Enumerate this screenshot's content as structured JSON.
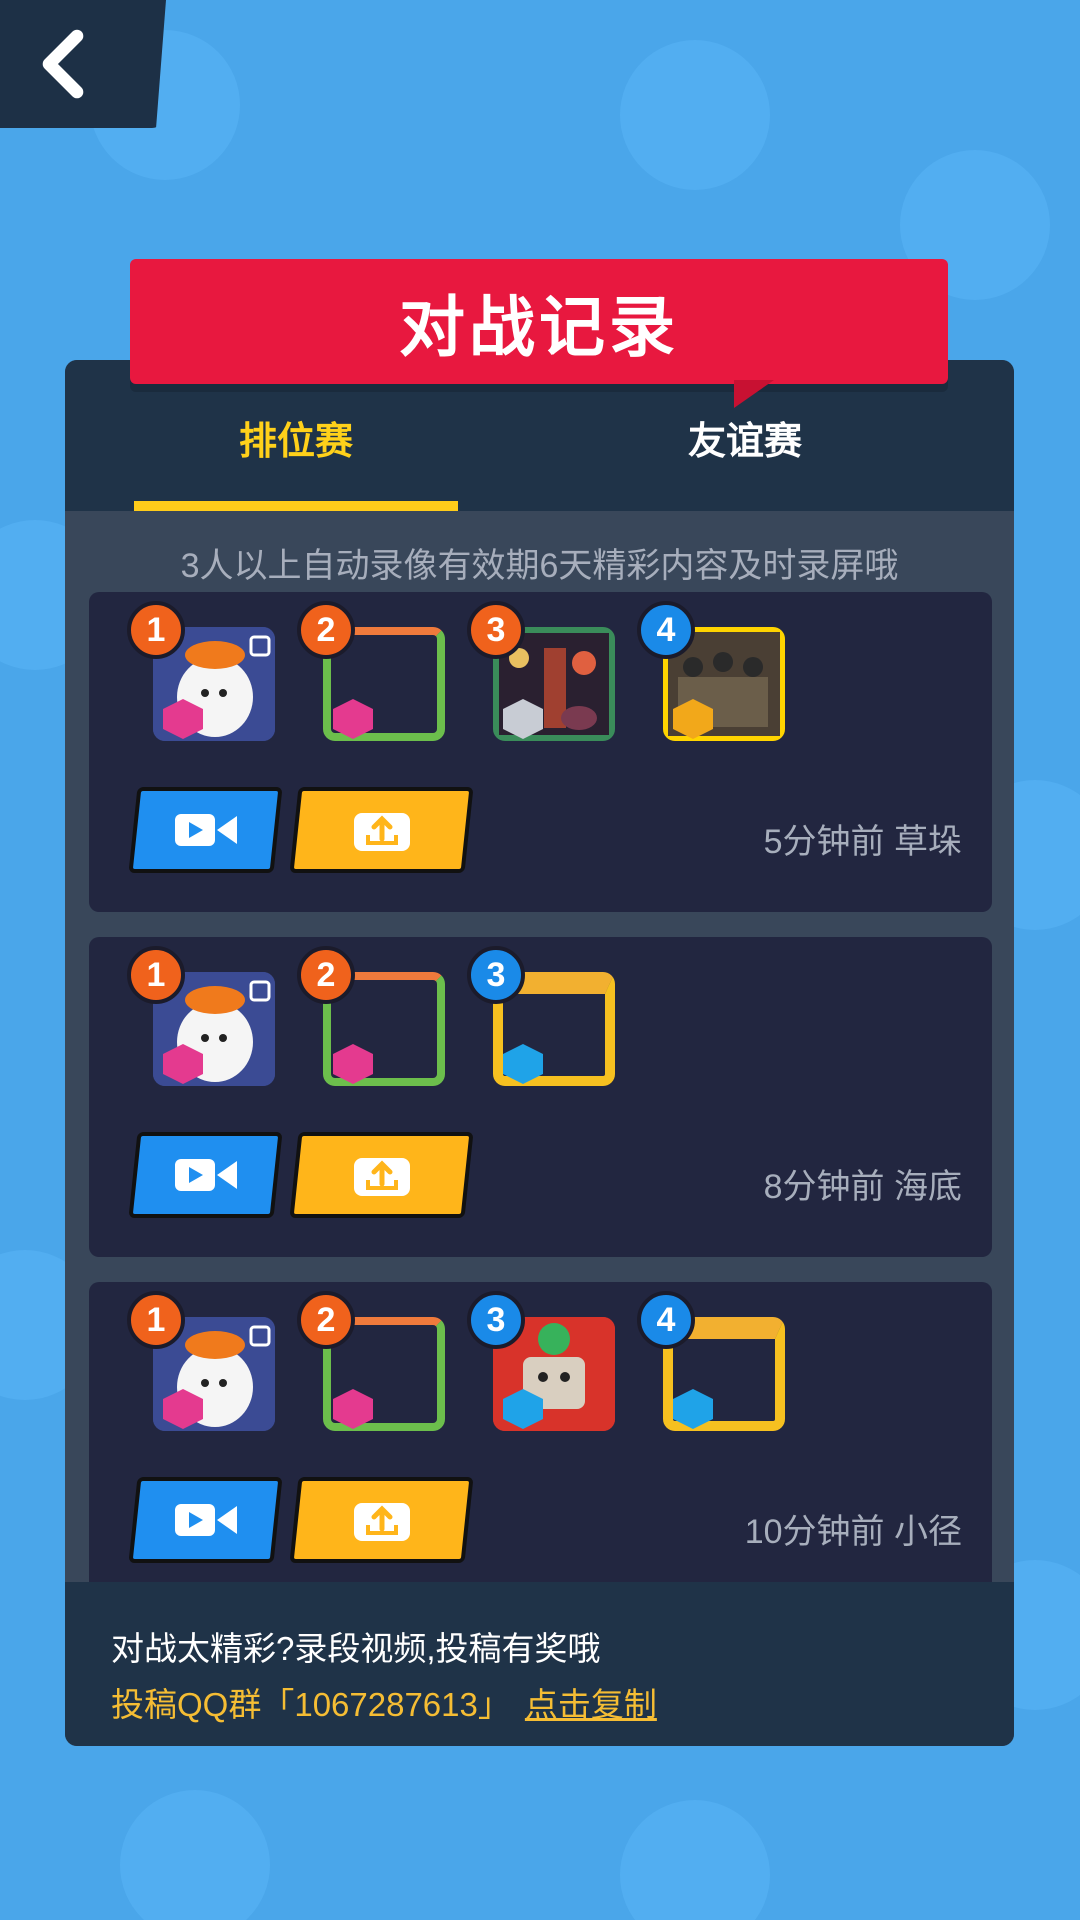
{
  "header": {
    "title": "对战记录"
  },
  "tabs": [
    {
      "label": "排位赛",
      "active": true
    },
    {
      "label": "友谊赛",
      "active": false
    }
  ],
  "notice": "3人以上自动录像有效期6天精彩内容及时录屏哦",
  "records": [
    {
      "meta": "5分钟前 草垛",
      "players": [
        {
          "rank": "1",
          "rank_color": "orange",
          "badge": "pink-gem"
        },
        {
          "rank": "2",
          "rank_color": "orange",
          "badge": "pink-gem"
        },
        {
          "rank": "3",
          "rank_color": "orange",
          "badge": "silver"
        },
        {
          "rank": "4",
          "rank_color": "blue",
          "badge": "gold-crown"
        }
      ]
    },
    {
      "meta": "8分钟前 海底",
      "players": [
        {
          "rank": "1",
          "rank_color": "orange",
          "badge": "pink-gem"
        },
        {
          "rank": "2",
          "rank_color": "orange",
          "badge": "pink-gem"
        },
        {
          "rank": "3",
          "rank_color": "blue",
          "badge": "blue-diamond"
        }
      ]
    },
    {
      "meta": "10分钟前 小径",
      "players": [
        {
          "rank": "1",
          "rank_color": "orange",
          "badge": "pink-gem"
        },
        {
          "rank": "2",
          "rank_color": "orange",
          "badge": "pink-gem"
        },
        {
          "rank": "3",
          "rank_color": "blue",
          "badge": "blue-diamond"
        },
        {
          "rank": "4",
          "rank_color": "blue",
          "badge": "blue-diamond"
        }
      ]
    }
  ],
  "footer": {
    "line1": "对战太精彩?录段视频,投稿有奖哦",
    "line2": "投稿QQ群「1067287613」",
    "copy_label": "点击复制"
  },
  "colors": {
    "accent_red": "#e8183f",
    "tab_active": "#ffd11a",
    "video_button": "#1f8ff0",
    "share_button": "#ffb51a"
  },
  "icons": {
    "back": "chevron-left-icon",
    "video": "video-camera-icon",
    "share": "upload-share-icon"
  }
}
